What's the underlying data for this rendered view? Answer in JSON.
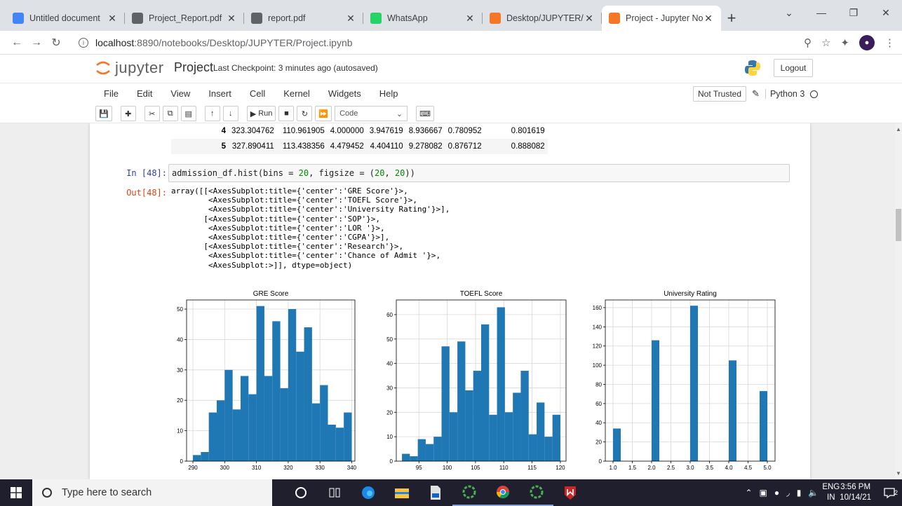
{
  "browser": {
    "tabs": [
      {
        "title": "Untitled document",
        "icon": "docs-icon",
        "color": "#4285f4"
      },
      {
        "title": "Project_Report.pdf",
        "icon": "globe-icon",
        "color": "#5f6368"
      },
      {
        "title": "report.pdf",
        "icon": "globe-icon",
        "color": "#5f6368"
      },
      {
        "title": "WhatsApp",
        "icon": "whatsapp-icon",
        "color": "#25d366"
      },
      {
        "title": "Desktop/JUPYTER/",
        "icon": "jupyter-icon",
        "color": "#f37726"
      },
      {
        "title": "Project - Jupyter No",
        "icon": "jupyter-notebook-icon",
        "color": "#f37726"
      }
    ],
    "url_host": "localhost",
    "url_path": ":8890/notebooks/Desktop/JUPYTER/Project.ipynb"
  },
  "jupyter": {
    "logo_text": "jupyter",
    "notebook_name": "Project",
    "checkpoint": "Last Checkpoint: 3 minutes ago  (autosaved)",
    "logout_label": "Logout",
    "menu": [
      "File",
      "Edit",
      "View",
      "Insert",
      "Cell",
      "Kernel",
      "Widgets",
      "Help"
    ],
    "trust_label": "Not Trusted",
    "kernel_name": "Python 3",
    "run_label": "Run",
    "cell_type": "Code"
  },
  "dataframe_rows": [
    {
      "idx": "4",
      "c1": "323.304762",
      "c2": "110.961905",
      "c3": "4.000000",
      "c4": "3.947619",
      "c5": "8.936667",
      "c6": "0.780952",
      "c7": "0.801619"
    },
    {
      "idx": "5",
      "c1": "327.890411",
      "c2": "113.438356",
      "c3": "4.479452",
      "c4": "4.404110",
      "c5": "9.278082",
      "c6": "0.876712",
      "c7": "0.888082"
    }
  ],
  "cell": {
    "in_prompt": "In [48]:",
    "out_prompt": "Out[48]:",
    "code_prefix": "admission_df.hist(bins = ",
    "code_bins": "20",
    "code_mid": ", figsize = (",
    "code_w": "20",
    "code_sep": ", ",
    "code_h": "20",
    "code_suffix": "))",
    "output": "array([[<AxesSubplot:title={'center':'GRE Score'}>,\n        <AxesSubplot:title={'center':'TOEFL Score'}>,\n        <AxesSubplot:title={'center':'University Rating'}>],\n       [<AxesSubplot:title={'center':'SOP'}>,\n        <AxesSubplot:title={'center':'LOR '}>,\n        <AxesSubplot:title={'center':'CGPA'}>],\n       [<AxesSubplot:title={'center':'Research'}>,\n        <AxesSubplot:title={'center':'Chance of Admit '}>,\n        <AxesSubplot:>]], dtype=object)"
  },
  "chart_data": [
    {
      "type": "bar",
      "title": "GRE Score",
      "color": "#1f77b4",
      "xlim": [
        288,
        341
      ],
      "ylim": [
        0,
        53
      ],
      "xticks": [
        290,
        300,
        310,
        320,
        330,
        340
      ],
      "yticks": [
        0,
        10,
        20,
        30,
        40,
        50
      ],
      "bin_edges": [
        290,
        292.5,
        295,
        297.5,
        300,
        302.5,
        305,
        307.5,
        310,
        312.5,
        315,
        317.5,
        320,
        322.5,
        325,
        327.5,
        330,
        332.5,
        335,
        337.5,
        340
      ],
      "values": [
        2,
        3,
        16,
        20,
        30,
        17,
        28,
        22,
        51,
        28,
        46,
        24,
        50,
        36,
        44,
        19,
        25,
        12,
        11,
        16
      ]
    },
    {
      "type": "bar",
      "title": "TOEFL Score",
      "color": "#1f77b4",
      "xlim": [
        91,
        121
      ],
      "ylim": [
        0,
        66
      ],
      "xticks": [
        95,
        100,
        105,
        110,
        115,
        120
      ],
      "yticks": [
        0,
        10,
        20,
        30,
        40,
        50,
        60
      ],
      "bin_edges": [
        92,
        93.4,
        94.8,
        96.2,
        97.6,
        99,
        100.4,
        101.8,
        103.2,
        104.6,
        106,
        107.4,
        108.8,
        110.2,
        111.6,
        113,
        114.4,
        115.8,
        117.2,
        118.6,
        120
      ],
      "values": [
        3,
        2,
        9,
        7,
        10,
        47,
        20,
        49,
        29,
        37,
        56,
        19,
        63,
        20,
        28,
        37,
        11,
        24,
        10,
        19
      ]
    },
    {
      "type": "bar",
      "title": "University Rating",
      "color": "#1f77b4",
      "xlim": [
        0.8,
        5.2
      ],
      "ylim": [
        0,
        168
      ],
      "xticks": [
        1.0,
        1.5,
        2.0,
        2.5,
        3.0,
        3.5,
        4.0,
        4.5,
        5.0
      ],
      "xtick_labels": [
        "1.0",
        "1.5",
        "2.0",
        "2.5",
        "3.0",
        "3.5",
        "4.0",
        "4.5",
        "5.0"
      ],
      "yticks": [
        0,
        20,
        40,
        60,
        80,
        100,
        120,
        140,
        160
      ],
      "bin_edges": [
        1,
        1.2,
        1.4,
        1.6,
        1.8,
        2,
        2.2,
        2.4,
        2.6,
        2.8,
        3,
        3.2,
        3.4,
        3.6,
        3.8,
        4,
        4.2,
        4.4,
        4.6,
        4.8,
        5
      ],
      "values": [
        34,
        0,
        0,
        0,
        0,
        126,
        0,
        0,
        0,
        0,
        162,
        0,
        0,
        0,
        0,
        105,
        0,
        0,
        0,
        73
      ]
    }
  ],
  "taskbar": {
    "search_placeholder": "Type here to search",
    "lang_top": "ENG",
    "lang_bottom": "IN",
    "time": "3:56 PM",
    "date": "10/14/21",
    "notification_count": "2"
  }
}
